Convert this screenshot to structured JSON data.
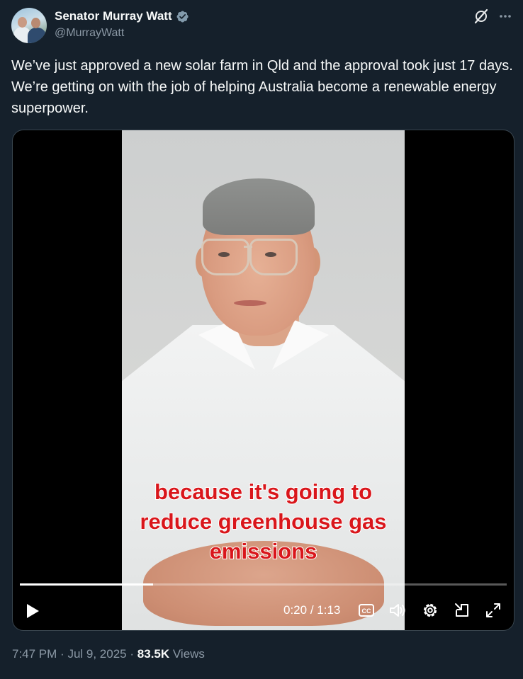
{
  "author": {
    "display_name": "Senator Murray Watt",
    "handle": "@MurrayWatt",
    "verified_icon": "verified-badge-icon"
  },
  "tweet": {
    "text": "We’ve just approved a new solar farm in Qld and the approval took just 17 days. We’re getting on with the job of helping Australia become a renewable energy superpower."
  },
  "video": {
    "caption": "because it's going to reduce greenhouse gas emissions",
    "current_time": "0:20",
    "separator": "/",
    "duration": "1:13",
    "progress": 0.274,
    "controls": [
      "play-icon",
      "closed-captions-icon",
      "volume-icon",
      "settings-icon",
      "dock-icon",
      "fullscreen-icon"
    ]
  },
  "footer": {
    "time": "7:47 PM",
    "dot1": "·",
    "date": "Jul 9, 2025",
    "dot2": "·",
    "views_count": "83.5K",
    "views_label": "Views"
  },
  "colors": {
    "background": "#15202b",
    "text_primary": "#f7f9f9",
    "text_secondary": "#8b98a5",
    "verified": "#829aab",
    "caption_red": "#d9161b"
  }
}
